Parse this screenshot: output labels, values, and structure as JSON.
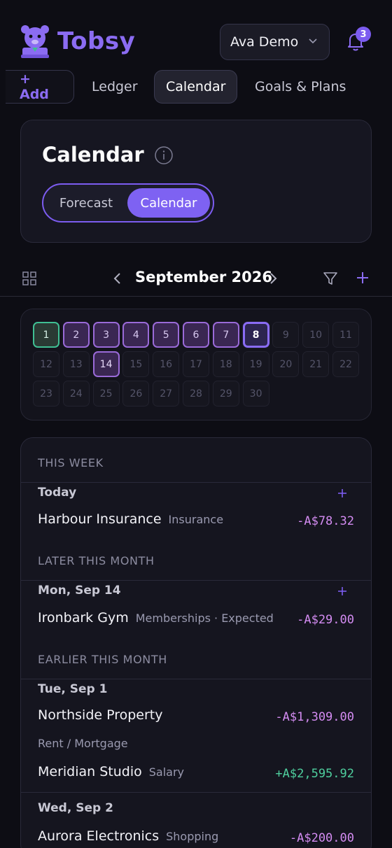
{
  "app": {
    "brand": "Tobsy",
    "user": "Ava Demo",
    "notifications": "3"
  },
  "tabs": {
    "add": "+ Add",
    "ledger": "Ledger",
    "calendar": "Calendar",
    "goals": "Goals & Plans"
  },
  "panel": {
    "title": "Calendar",
    "seg_forecast": "Forecast",
    "seg_calendar": "Calendar"
  },
  "nav": {
    "month": "September 2026"
  },
  "days": [
    "1",
    "2",
    "3",
    "4",
    "5",
    "6",
    "7",
    "8",
    "9",
    "10",
    "11",
    "12",
    "13",
    "14",
    "15",
    "16",
    "17",
    "18",
    "19",
    "20",
    "21",
    "22",
    "23",
    "24",
    "25",
    "26",
    "27",
    "28",
    "29",
    "30"
  ],
  "events": {
    "this_week": "THIS WEEK",
    "today_label": "Today",
    "e1": {
      "name": "Harbour Insurance",
      "cat": "Insurance",
      "amount": "-A$78.32"
    },
    "later_month": "LATER THIS MONTH",
    "sep14": "Mon, Sep 14",
    "e2": {
      "name": "Ironbark Gym",
      "cat": "Memberships · Expected",
      "amount": "-A$29.00"
    },
    "earlier_month": "EARLIER THIS MONTH",
    "sep1": "Tue, Sep 1",
    "e3": {
      "name": "Northside Property",
      "cat": "Rent / Mortgage",
      "amount": "-A$1,309.00"
    },
    "e4": {
      "name": "Meridian Studio",
      "cat": "Salary",
      "amount": "+A$2,595.92"
    },
    "sep2": "Wed, Sep 2",
    "e5": {
      "name": "Aurora Electronics",
      "cat": "Shopping",
      "amount": "-A$200.00"
    }
  },
  "colors": {
    "accent": "#7c5cf0",
    "negative": "#d48cf2",
    "positive": "#4fcf9e",
    "today": "#3fbf93"
  }
}
